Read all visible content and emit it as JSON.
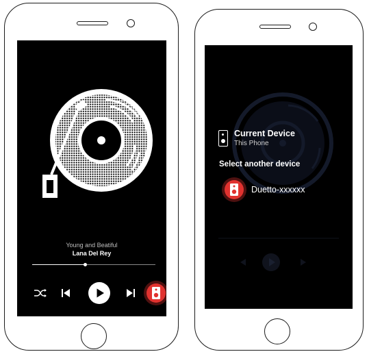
{
  "player": {
    "song_title": "Young and Beatiful",
    "artist": "Lana Del Rey",
    "progress": 0.43
  },
  "device_menu": {
    "current_label": "Current Device",
    "current_device": "This Phone",
    "select_label": "Select another device",
    "devices": [
      {
        "name": "Duetto-xxxxxx"
      }
    ]
  },
  "colors": {
    "screen": "#000000",
    "accent_red": "#e1322f",
    "text_primary": "#ffffff",
    "text_secondary": "#bdbdbd",
    "dim_overlay": "#141a2a"
  },
  "icons": [
    "record-player-icon",
    "shuffle-icon",
    "previous-icon",
    "play-icon",
    "next-icon",
    "speaker-icon"
  ]
}
